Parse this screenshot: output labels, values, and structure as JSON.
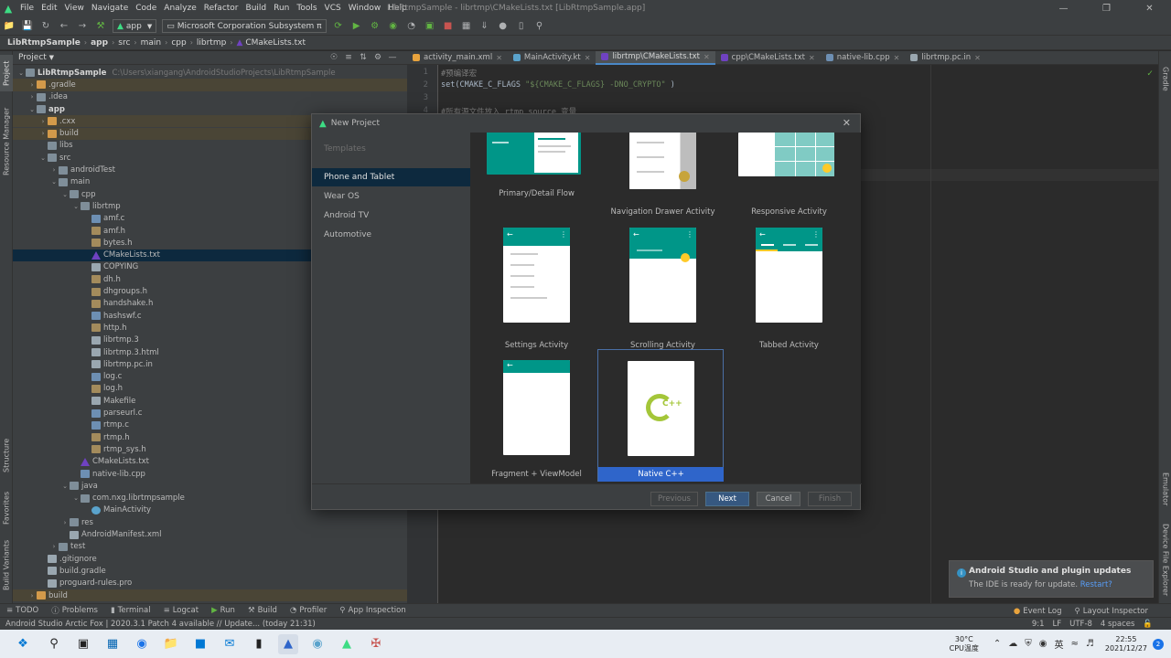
{
  "window": {
    "title": "LibRtmpSample - librtmp\\CMakeLists.txt [LibRtmpSample.app]"
  },
  "menu": [
    "File",
    "Edit",
    "View",
    "Navigate",
    "Code",
    "Analyze",
    "Refactor",
    "Build",
    "Run",
    "Tools",
    "VCS",
    "Window",
    "Help"
  ],
  "toolbar": {
    "module": "app",
    "device": "Microsoft Corporation Subsystem π"
  },
  "breadcrumb": [
    "LibRtmpSample",
    "app",
    "src",
    "main",
    "cpp",
    "librtmp",
    "CMakeLists.txt"
  ],
  "project_panel": {
    "title": "Project",
    "root_name": "LibRtmpSample",
    "root_path": "C:\\Users\\xiangang\\AndroidStudioProjects\\LibRtmpSample",
    "tree": [
      {
        "label": ".gradle",
        "depth": 1,
        "arrow": "›",
        "icon": "folder-o",
        "style": "excl"
      },
      {
        "label": ".idea",
        "depth": 1,
        "arrow": "›",
        "icon": "folder",
        "style": ""
      },
      {
        "label": "app",
        "depth": 1,
        "arrow": "⌄",
        "icon": "folder",
        "style": "bold"
      },
      {
        "label": ".cxx",
        "depth": 2,
        "arrow": "›",
        "icon": "folder-o",
        "style": "excl"
      },
      {
        "label": "build",
        "depth": 2,
        "arrow": "›",
        "icon": "folder-o",
        "style": "excl"
      },
      {
        "label": "libs",
        "depth": 2,
        "arrow": "",
        "icon": "folder",
        "style": ""
      },
      {
        "label": "src",
        "depth": 2,
        "arrow": "⌄",
        "icon": "folder",
        "style": ""
      },
      {
        "label": "androidTest",
        "depth": 3,
        "arrow": "›",
        "icon": "folder",
        "style": ""
      },
      {
        "label": "main",
        "depth": 3,
        "arrow": "⌄",
        "icon": "folder",
        "style": ""
      },
      {
        "label": "cpp",
        "depth": 4,
        "arrow": "⌄",
        "icon": "folder",
        "style": ""
      },
      {
        "label": "librtmp",
        "depth": 5,
        "arrow": "⌄",
        "icon": "folder",
        "style": ""
      },
      {
        "label": "amf.c",
        "depth": 6,
        "arrow": "",
        "icon": "cfile",
        "style": ""
      },
      {
        "label": "amf.h",
        "depth": 6,
        "arrow": "",
        "icon": "hfile",
        "style": ""
      },
      {
        "label": "bytes.h",
        "depth": 6,
        "arrow": "",
        "icon": "hfile",
        "style": ""
      },
      {
        "label": "CMakeLists.txt",
        "depth": 6,
        "arrow": "",
        "icon": "cmake",
        "style": "sel"
      },
      {
        "label": "COPYING",
        "depth": 6,
        "arrow": "",
        "icon": "file",
        "style": ""
      },
      {
        "label": "dh.h",
        "depth": 6,
        "arrow": "",
        "icon": "hfile",
        "style": ""
      },
      {
        "label": "dhgroups.h",
        "depth": 6,
        "arrow": "",
        "icon": "hfile",
        "style": ""
      },
      {
        "label": "handshake.h",
        "depth": 6,
        "arrow": "",
        "icon": "hfile",
        "style": ""
      },
      {
        "label": "hashswf.c",
        "depth": 6,
        "arrow": "",
        "icon": "cfile",
        "style": ""
      },
      {
        "label": "http.h",
        "depth": 6,
        "arrow": "",
        "icon": "hfile",
        "style": ""
      },
      {
        "label": "librtmp.3",
        "depth": 6,
        "arrow": "",
        "icon": "file",
        "style": ""
      },
      {
        "label": "librtmp.3.html",
        "depth": 6,
        "arrow": "",
        "icon": "file",
        "style": ""
      },
      {
        "label": "librtmp.pc.in",
        "depth": 6,
        "arrow": "",
        "icon": "file",
        "style": ""
      },
      {
        "label": "log.c",
        "depth": 6,
        "arrow": "",
        "icon": "cfile",
        "style": ""
      },
      {
        "label": "log.h",
        "depth": 6,
        "arrow": "",
        "icon": "hfile",
        "style": ""
      },
      {
        "label": "Makefile",
        "depth": 6,
        "arrow": "",
        "icon": "file",
        "style": ""
      },
      {
        "label": "parseurl.c",
        "depth": 6,
        "arrow": "",
        "icon": "cfile",
        "style": ""
      },
      {
        "label": "rtmp.c",
        "depth": 6,
        "arrow": "",
        "icon": "cfile",
        "style": ""
      },
      {
        "label": "rtmp.h",
        "depth": 6,
        "arrow": "",
        "icon": "hfile",
        "style": ""
      },
      {
        "label": "rtmp_sys.h",
        "depth": 6,
        "arrow": "",
        "icon": "hfile",
        "style": ""
      },
      {
        "label": "CMakeLists.txt",
        "depth": 5,
        "arrow": "",
        "icon": "cmake",
        "style": ""
      },
      {
        "label": "native-lib.cpp",
        "depth": 5,
        "arrow": "",
        "icon": "cfile",
        "style": ""
      },
      {
        "label": "java",
        "depth": 4,
        "arrow": "⌄",
        "icon": "folder",
        "style": ""
      },
      {
        "label": "com.nxg.librtmpsample",
        "depth": 5,
        "arrow": "⌄",
        "icon": "folder",
        "style": ""
      },
      {
        "label": "MainActivity",
        "depth": 6,
        "arrow": "",
        "icon": "kotlin",
        "style": ""
      },
      {
        "label": "res",
        "depth": 4,
        "arrow": "›",
        "icon": "folder",
        "style": ""
      },
      {
        "label": "AndroidManifest.xml",
        "depth": 4,
        "arrow": "",
        "icon": "file",
        "style": ""
      },
      {
        "label": "test",
        "depth": 3,
        "arrow": "›",
        "icon": "folder",
        "style": ""
      },
      {
        "label": ".gitignore",
        "depth": 2,
        "arrow": "",
        "icon": "file",
        "style": ""
      },
      {
        "label": "build.gradle",
        "depth": 2,
        "arrow": "",
        "icon": "file",
        "style": ""
      },
      {
        "label": "proguard-rules.pro",
        "depth": 2,
        "arrow": "",
        "icon": "file",
        "style": ""
      },
      {
        "label": "build",
        "depth": 1,
        "arrow": "›",
        "icon": "folder-o",
        "style": "excl"
      }
    ]
  },
  "editor": {
    "tabs": [
      {
        "label": "activity_main.xml",
        "color": "#e8a33d",
        "active": false
      },
      {
        "label": "MainActivity.kt",
        "color": "#5aa3cc",
        "active": false
      },
      {
        "label": "librtmp\\CMakeLists.txt",
        "color": "#6f42c1",
        "active": true
      },
      {
        "label": "cpp\\CMakeLists.txt",
        "color": "#6f42c1",
        "active": false
      },
      {
        "label": "native-lib.cpp",
        "color": "#6d8fb3",
        "active": false
      },
      {
        "label": "librtmp.pc.in",
        "color": "#9aa7b0",
        "active": false
      }
    ],
    "line_numbers": [
      "1",
      "2",
      "3",
      "4"
    ],
    "code": {
      "line1": "#预编译宏",
      "line2_a": "set(CMAKE_C_FLAGS ",
      "line2_b": "\"${CMAKE_C_FLAGS} -DNO_CRYPTO\"",
      "line2_c": " )",
      "line4": "#所有源文件放入 rtmp_source 变量"
    }
  },
  "dialog": {
    "title": "New Project",
    "templates_header": "Templates",
    "categories": [
      "Phone and Tablet",
      "Wear OS",
      "Android TV",
      "Automotive"
    ],
    "templates": [
      {
        "name": "Primary/Detail Flow"
      },
      {
        "name": "Navigation Drawer Activity"
      },
      {
        "name": "Responsive Activity"
      },
      {
        "name": "Settings Activity"
      },
      {
        "name": "Scrolling Activity"
      },
      {
        "name": "Tabbed Activity"
      },
      {
        "name": "Fragment + ViewModel"
      },
      {
        "name": "Native C++"
      }
    ],
    "cpp_badge": "C++",
    "buttons": {
      "previous": "Previous",
      "next": "Next",
      "cancel": "Cancel",
      "finish": "Finish"
    }
  },
  "notification": {
    "title": "Android Studio and plugin updates",
    "body": "The IDE is ready for update.",
    "link": "Restart?"
  },
  "tool_windows": [
    "TODO",
    "Problems",
    "Terminal",
    "Logcat",
    "Run",
    "Build",
    "Profiler",
    "App Inspection"
  ],
  "tool_windows_right": [
    "Event Log",
    "Layout Inspector"
  ],
  "status": {
    "message": "Android Studio Arctic Fox | 2020.3.1 Patch 4 available // Update... (today 21:31)",
    "position": "9:1",
    "line_sep": "LF",
    "encoding": "UTF-8",
    "indent": "4 spaces"
  },
  "side_tabs_left": [
    "Project",
    "Resource Manager",
    "Structure",
    "Favorites",
    "Build Variants"
  ],
  "side_tabs_right": [
    "Gradle",
    "Emulator",
    "Device File Explorer"
  ],
  "taskbar": {
    "temp": "30°C",
    "temp_label": "CPU温度",
    "ime": "英",
    "time": "22:55",
    "date": "2021/12/27",
    "notif_count": "2"
  }
}
